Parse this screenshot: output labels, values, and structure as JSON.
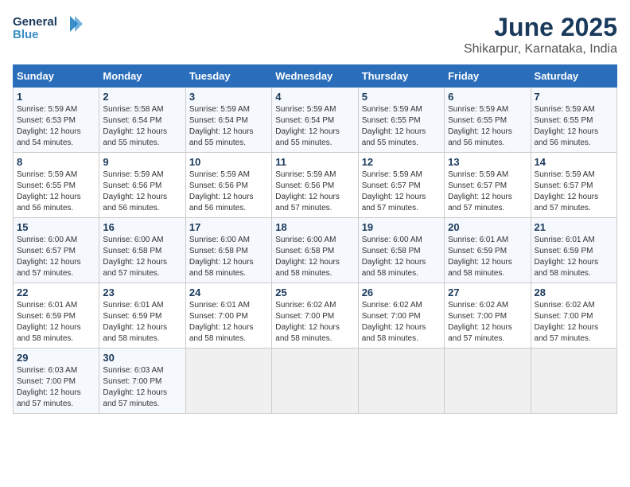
{
  "logo": {
    "line1": "General",
    "line2": "Blue"
  },
  "title": "June 2025",
  "subtitle": "Shikarpur, Karnataka, India",
  "weekdays": [
    "Sunday",
    "Monday",
    "Tuesday",
    "Wednesday",
    "Thursday",
    "Friday",
    "Saturday"
  ],
  "weeks": [
    [
      {
        "day": 1,
        "sunrise": "5:59 AM",
        "sunset": "6:53 PM",
        "daylight": "12 hours and 54 minutes."
      },
      {
        "day": 2,
        "sunrise": "5:58 AM",
        "sunset": "6:54 PM",
        "daylight": "12 hours and 55 minutes."
      },
      {
        "day": 3,
        "sunrise": "5:59 AM",
        "sunset": "6:54 PM",
        "daylight": "12 hours and 55 minutes."
      },
      {
        "day": 4,
        "sunrise": "5:59 AM",
        "sunset": "6:54 PM",
        "daylight": "12 hours and 55 minutes."
      },
      {
        "day": 5,
        "sunrise": "5:59 AM",
        "sunset": "6:55 PM",
        "daylight": "12 hours and 55 minutes."
      },
      {
        "day": 6,
        "sunrise": "5:59 AM",
        "sunset": "6:55 PM",
        "daylight": "12 hours and 56 minutes."
      },
      {
        "day": 7,
        "sunrise": "5:59 AM",
        "sunset": "6:55 PM",
        "daylight": "12 hours and 56 minutes."
      }
    ],
    [
      {
        "day": 8,
        "sunrise": "5:59 AM",
        "sunset": "6:55 PM",
        "daylight": "12 hours and 56 minutes."
      },
      {
        "day": 9,
        "sunrise": "5:59 AM",
        "sunset": "6:56 PM",
        "daylight": "12 hours and 56 minutes."
      },
      {
        "day": 10,
        "sunrise": "5:59 AM",
        "sunset": "6:56 PM",
        "daylight": "12 hours and 56 minutes."
      },
      {
        "day": 11,
        "sunrise": "5:59 AM",
        "sunset": "6:56 PM",
        "daylight": "12 hours and 57 minutes."
      },
      {
        "day": 12,
        "sunrise": "5:59 AM",
        "sunset": "6:57 PM",
        "daylight": "12 hours and 57 minutes."
      },
      {
        "day": 13,
        "sunrise": "5:59 AM",
        "sunset": "6:57 PM",
        "daylight": "12 hours and 57 minutes."
      },
      {
        "day": 14,
        "sunrise": "5:59 AM",
        "sunset": "6:57 PM",
        "daylight": "12 hours and 57 minutes."
      }
    ],
    [
      {
        "day": 15,
        "sunrise": "6:00 AM",
        "sunset": "6:57 PM",
        "daylight": "12 hours and 57 minutes."
      },
      {
        "day": 16,
        "sunrise": "6:00 AM",
        "sunset": "6:58 PM",
        "daylight": "12 hours and 57 minutes."
      },
      {
        "day": 17,
        "sunrise": "6:00 AM",
        "sunset": "6:58 PM",
        "daylight": "12 hours and 58 minutes."
      },
      {
        "day": 18,
        "sunrise": "6:00 AM",
        "sunset": "6:58 PM",
        "daylight": "12 hours and 58 minutes."
      },
      {
        "day": 19,
        "sunrise": "6:00 AM",
        "sunset": "6:58 PM",
        "daylight": "12 hours and 58 minutes."
      },
      {
        "day": 20,
        "sunrise": "6:01 AM",
        "sunset": "6:59 PM",
        "daylight": "12 hours and 58 minutes."
      },
      {
        "day": 21,
        "sunrise": "6:01 AM",
        "sunset": "6:59 PM",
        "daylight": "12 hours and 58 minutes."
      }
    ],
    [
      {
        "day": 22,
        "sunrise": "6:01 AM",
        "sunset": "6:59 PM",
        "daylight": "12 hours and 58 minutes."
      },
      {
        "day": 23,
        "sunrise": "6:01 AM",
        "sunset": "6:59 PM",
        "daylight": "12 hours and 58 minutes."
      },
      {
        "day": 24,
        "sunrise": "6:01 AM",
        "sunset": "7:00 PM",
        "daylight": "12 hours and 58 minutes."
      },
      {
        "day": 25,
        "sunrise": "6:02 AM",
        "sunset": "7:00 PM",
        "daylight": "12 hours and 58 minutes."
      },
      {
        "day": 26,
        "sunrise": "6:02 AM",
        "sunset": "7:00 PM",
        "daylight": "12 hours and 58 minutes."
      },
      {
        "day": 27,
        "sunrise": "6:02 AM",
        "sunset": "7:00 PM",
        "daylight": "12 hours and 57 minutes."
      },
      {
        "day": 28,
        "sunrise": "6:02 AM",
        "sunset": "7:00 PM",
        "daylight": "12 hours and 57 minutes."
      }
    ],
    [
      {
        "day": 29,
        "sunrise": "6:03 AM",
        "sunset": "7:00 PM",
        "daylight": "12 hours and 57 minutes."
      },
      {
        "day": 30,
        "sunrise": "6:03 AM",
        "sunset": "7:00 PM",
        "daylight": "12 hours and 57 minutes."
      },
      null,
      null,
      null,
      null,
      null
    ]
  ],
  "labels": {
    "sunrise": "Sunrise:",
    "sunset": "Sunset:",
    "daylight": "Daylight:"
  }
}
